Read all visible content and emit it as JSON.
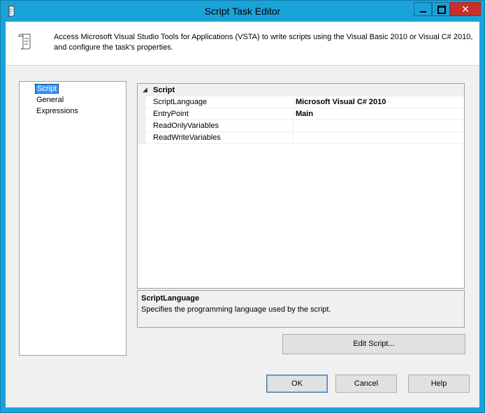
{
  "window": {
    "title": "Script Task Editor",
    "close_glyph": "✕",
    "accent_color": "#1aa3d9",
    "close_color": "#c7312b"
  },
  "header": {
    "description_line1": "Access Microsoft Visual Studio Tools for Applications (VSTA) to write scripts using the Visual Basic 2010 or Visual C# 2010,",
    "description_line2": "and configure the task's properties.",
    "icon": "script-scroll-icon"
  },
  "nav": {
    "items": [
      {
        "label": "Script",
        "selected": true
      },
      {
        "label": "General",
        "selected": false
      },
      {
        "label": "Expressions",
        "selected": false
      }
    ]
  },
  "properties": {
    "category": "Script",
    "category_toggle": "◢",
    "rows": [
      {
        "name": "ScriptLanguage",
        "value": "Microsoft Visual C# 2010"
      },
      {
        "name": "EntryPoint",
        "value": "Main"
      },
      {
        "name": "ReadOnlyVariables",
        "value": ""
      },
      {
        "name": "ReadWriteVariables",
        "value": ""
      }
    ]
  },
  "help": {
    "title": "ScriptLanguage",
    "text": "Specifies the programming language used by the script."
  },
  "buttons": {
    "edit_script": "Edit Script...",
    "ok": "OK",
    "cancel": "Cancel",
    "help": "Help"
  }
}
